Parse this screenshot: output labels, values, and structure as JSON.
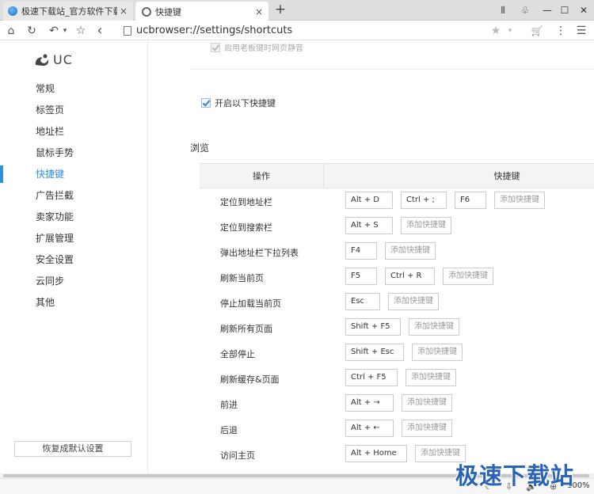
{
  "tabs": [
    {
      "title": "极速下载站_官方软件下载_绿色",
      "close": "×"
    },
    {
      "title": "快捷键",
      "close": "×"
    }
  ],
  "new_tab_symbol": "+",
  "window_controls": {
    "menu": "⫴",
    "skin": "♧",
    "minimize": "—",
    "maximize": "☐",
    "close": "✕"
  },
  "address_bar": {
    "url": "ucbrowser://settings/shortcuts"
  },
  "icons": {
    "home": "⌂",
    "refresh": "↻",
    "undo": "↶",
    "favorite": "☆",
    "back": "‹",
    "bookmark_star": "★",
    "dropdown": "▾",
    "cart": "🛒",
    "menu": "⋮",
    "more": "☰",
    "moon": "☾",
    "download": "⇩",
    "sound": "🔈",
    "zoom": "⊕"
  },
  "sidebar": {
    "logo_text": "UC",
    "items": [
      {
        "label": "常规"
      },
      {
        "label": "标签页"
      },
      {
        "label": "地址栏"
      },
      {
        "label": "鼠标手势"
      },
      {
        "label": "快捷键",
        "active": true
      },
      {
        "label": "广告拦截"
      },
      {
        "label": "卖家功能"
      },
      {
        "label": "扩展管理"
      },
      {
        "label": "安全设置"
      },
      {
        "label": "云同步"
      },
      {
        "label": "其他"
      }
    ],
    "reset_button": "恢复成默认设置"
  },
  "main": {
    "boss_key_mute_label": "启用老板键时网页静音",
    "enable_shortcuts_label": "开启以下快捷键",
    "section_title": "浏览",
    "table": {
      "headers": {
        "operation": "操作",
        "shortcut": "快捷键"
      },
      "add_label": "添加快捷键",
      "rows": [
        {
          "label": "定位到地址栏",
          "keys": [
            "Alt + D",
            "Ctrl + ;",
            "F6"
          ]
        },
        {
          "label": "定位到搜索栏",
          "keys": [
            "Alt + S"
          ]
        },
        {
          "label": "弹出地址栏下拉列表",
          "keys": [
            "F4"
          ]
        },
        {
          "label": "刷新当前页",
          "keys": [
            "F5",
            "Ctrl + R"
          ]
        },
        {
          "label": "停止加载当前页",
          "keys": [
            "Esc"
          ]
        },
        {
          "label": "刷新所有页面",
          "keys": [
            "Shift + F5"
          ]
        },
        {
          "label": "全部停止",
          "keys": [
            "Shift + Esc"
          ]
        },
        {
          "label": "刷新缓存&页面",
          "keys": [
            "Ctrl + F5"
          ]
        },
        {
          "label": "前进",
          "keys": [
            "Alt + →"
          ]
        },
        {
          "label": "后退",
          "keys": [
            "Alt + ←"
          ]
        },
        {
          "label": "访问主页",
          "keys": [
            "Alt + Home"
          ]
        }
      ]
    }
  },
  "status_bar": {
    "zoom": "100%"
  },
  "watermark": "极速下载站"
}
